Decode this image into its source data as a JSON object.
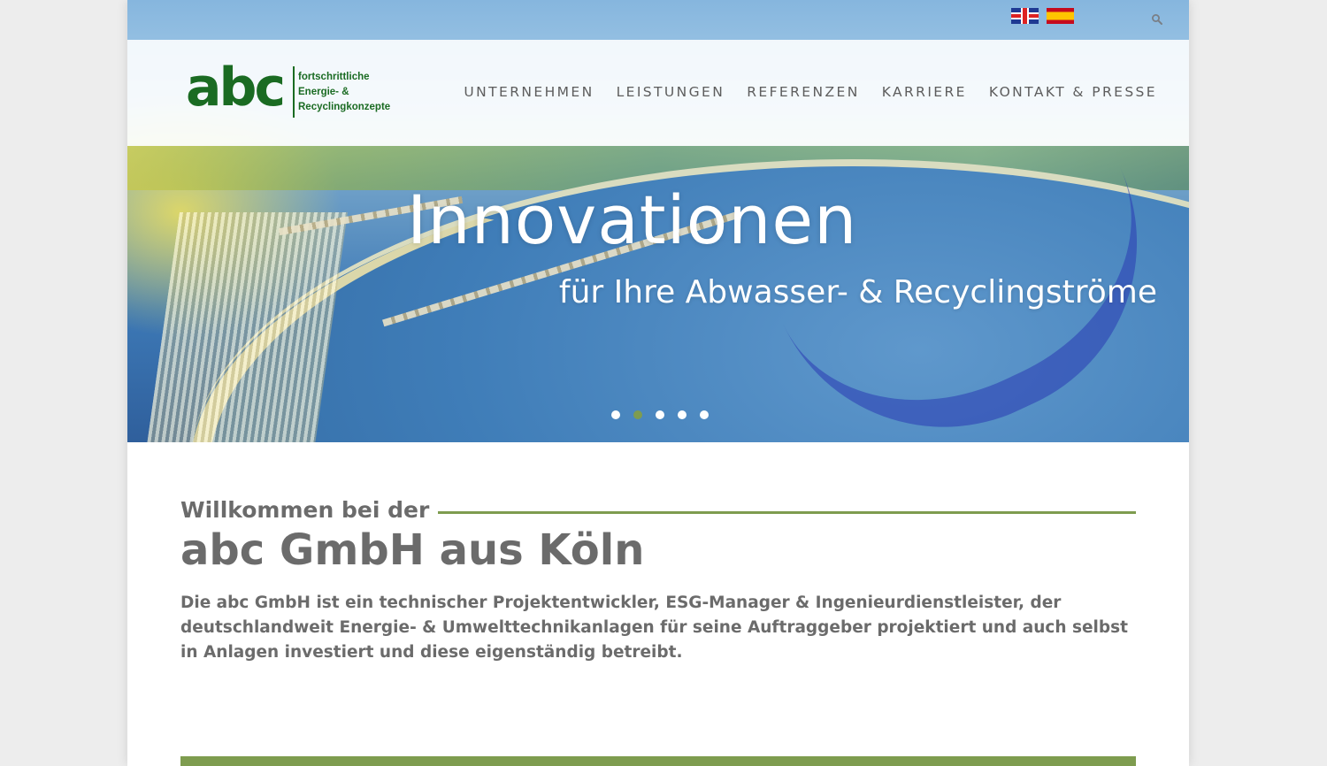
{
  "language_flags": [
    {
      "name": "English",
      "icon": "flag-uk-icon"
    },
    {
      "name": "Español",
      "icon": "flag-es-icon"
    }
  ],
  "search": {
    "icon": "search-icon"
  },
  "logo": {
    "mark": "abc",
    "tagline": [
      "fortschrittliche",
      "Energie- &",
      "Recyclingkonzepte"
    ]
  },
  "nav": {
    "items": [
      "UNTERNEHMEN",
      "LEISTUNGEN",
      "REFERENZEN",
      "KARRIERE",
      "KONTAKT & PRESSE"
    ]
  },
  "hero": {
    "title": "Innovationen",
    "subtitle": "für Ihre Abwasser- & Recyclingströme",
    "slides_total": 5,
    "active_slide": 2
  },
  "content": {
    "welcome": "Willkommen bei der",
    "company": "abc GmbH aus Köln",
    "intro": "Die abc GmbH ist ein technischer Projektentwickler, ESG-Manager & Ingenieurdienstleister, der deutschlandweit Energie- & Umwelttechnikanlagen für seine Auftraggeber projektiert und auch selbst in Anlagen investiert und diese eigenständig betreibt."
  },
  "colors": {
    "brand_green": "#1a6b22",
    "accent_green": "#7e9c4f",
    "text_gray": "#6b6b6b",
    "nav_gray": "#5d5d5d"
  }
}
